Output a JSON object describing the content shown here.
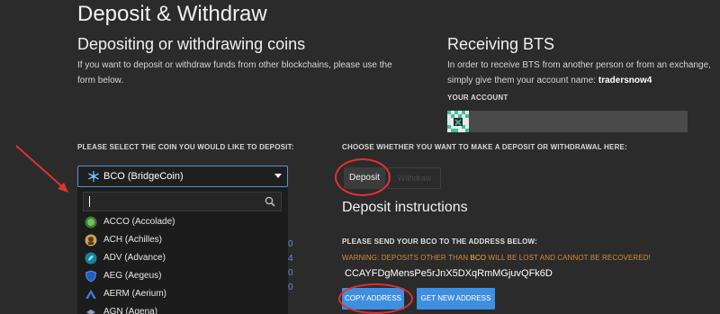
{
  "page": {
    "title": "Deposit & Withdraw"
  },
  "left": {
    "heading": "Depositing or withdrawing coins",
    "desc_line1": "If you want to deposit or withdraw funds from other blockchains, please use the",
    "desc_line2": "form below.",
    "select_prompt": "PLEASE SELECT THE COIN YOU WOULD LIKE TO DEPOSIT:"
  },
  "right": {
    "heading": "Receiving BTS",
    "desc_line1": "In order to receive BTS from another person or from an exchange,",
    "desc_line2_prefix": "simply give them your account name: ",
    "account_name": "tradersnow4",
    "account_label": "YOUR ACCOUNT",
    "choose_prompt": "CHOOSE WHETHER YOU WANT TO MAKE A DEPOSIT OR WITHDRAWAL HERE:"
  },
  "coin_select": {
    "selected": "BCO (BridgeCoin)",
    "search_value": "",
    "options": [
      {
        "label": "ACCO (Accolade)",
        "icon": "accolade-icon",
        "color": "#4fa64a"
      },
      {
        "label": "ACH (Achilles)",
        "icon": "achilles-icon",
        "color": "#b98a3e"
      },
      {
        "label": "ADV (Advance)",
        "icon": "advance-icon",
        "color": "#3aa6c8"
      },
      {
        "label": "AEG (Aegeus)",
        "icon": "aegeus-icon",
        "color": "#2b6fd6"
      },
      {
        "label": "AERM (Aerium)",
        "icon": "aerium-icon",
        "color": "#3b7fe0"
      },
      {
        "label": "AGN (Agena)",
        "icon": "agena-icon",
        "color": "#8aa0c0"
      }
    ]
  },
  "tabs": {
    "deposit": "Deposit",
    "withdraw": "Withdraw"
  },
  "deposit": {
    "heading": "Deposit instructions",
    "send_prefix": "PLEASE SEND YOUR BCO TO THE ADDRESS BELOW:",
    "warning_prefix": "WARNING: DEPOSITS OTHER THAN ",
    "warning_coin": "BCO",
    "warning_suffix": " WILL BE LOST AND CANNOT BE RECOVERED!",
    "address": "CCAYFDgMensPe5rJnX5DXqRmMGjuvQFk6D",
    "copy_label": "COPY ADDRESS",
    "new_label": "GET NEW ADDRESS"
  },
  "peek": [
    "0",
    "4",
    "0",
    "0"
  ],
  "colors": {
    "accent_blue": "#3f8fe0",
    "warning": "#d38a3c",
    "annotation_red": "#e03030"
  }
}
